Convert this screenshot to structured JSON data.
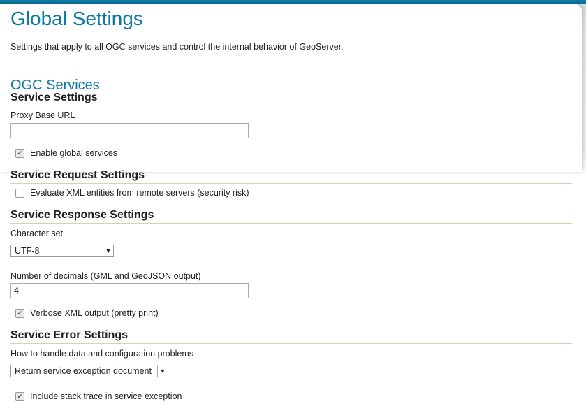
{
  "page": {
    "title": "Global Settings",
    "description": "Settings that apply to all OGC services and control the internal behavior of GeoServer."
  },
  "ogc": {
    "title": "OGC Services",
    "service_settings": {
      "heading": "Service Settings",
      "proxy_label": "Proxy Base URL",
      "proxy_value": "",
      "enable_global": {
        "label": "Enable global services",
        "checked": true
      }
    },
    "request_settings": {
      "heading": "Service Request Settings",
      "xml_entities": {
        "label": "Evaluate XML entities from remote servers (security risk)",
        "checked": false
      }
    },
    "response_settings": {
      "heading": "Service Response Settings",
      "charset_label": "Character set",
      "charset_value": "UTF-8",
      "decimals_label": "Number of decimals (GML and GeoJSON output)",
      "decimals_value": "4",
      "verbose": {
        "label": "Verbose XML output (pretty print)",
        "checked": true
      }
    },
    "error_settings": {
      "heading": "Service Error Settings",
      "handle_label": "How to handle data and configuration problems",
      "handle_value": "Return service exception document",
      "stack_trace": {
        "label": "Include stack trace in service exception",
        "checked": true
      }
    }
  },
  "icons": {
    "check": "check-icon",
    "dropdown": "chevron-down-icon"
  }
}
